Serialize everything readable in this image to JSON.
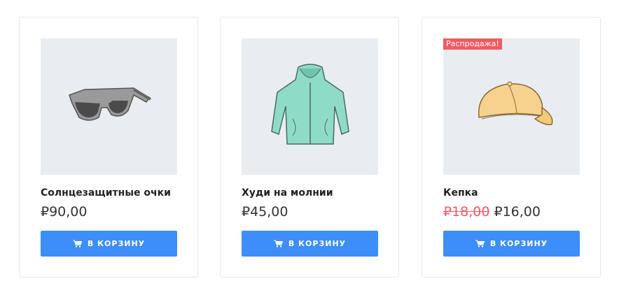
{
  "products": [
    {
      "title": "Солнцезащитные очки",
      "price": "₽90,00",
      "button_label": "В КОРЗИНУ",
      "image_icon": "sunglasses-icon"
    },
    {
      "title": "Худи на молнии",
      "price": "₽45,00",
      "button_label": "В КОРЗИНУ",
      "image_icon": "hoodie-icon"
    },
    {
      "title": "Кепка",
      "sale_badge": "Распродажа!",
      "old_price": "₽18,00",
      "price": "₽16,00",
      "button_label": "В КОРЗИНУ",
      "image_icon": "cap-icon"
    }
  ],
  "colors": {
    "button": "#3d8ef8",
    "sale": "#ef5b62",
    "thumb_bg": "#e9edf2"
  }
}
